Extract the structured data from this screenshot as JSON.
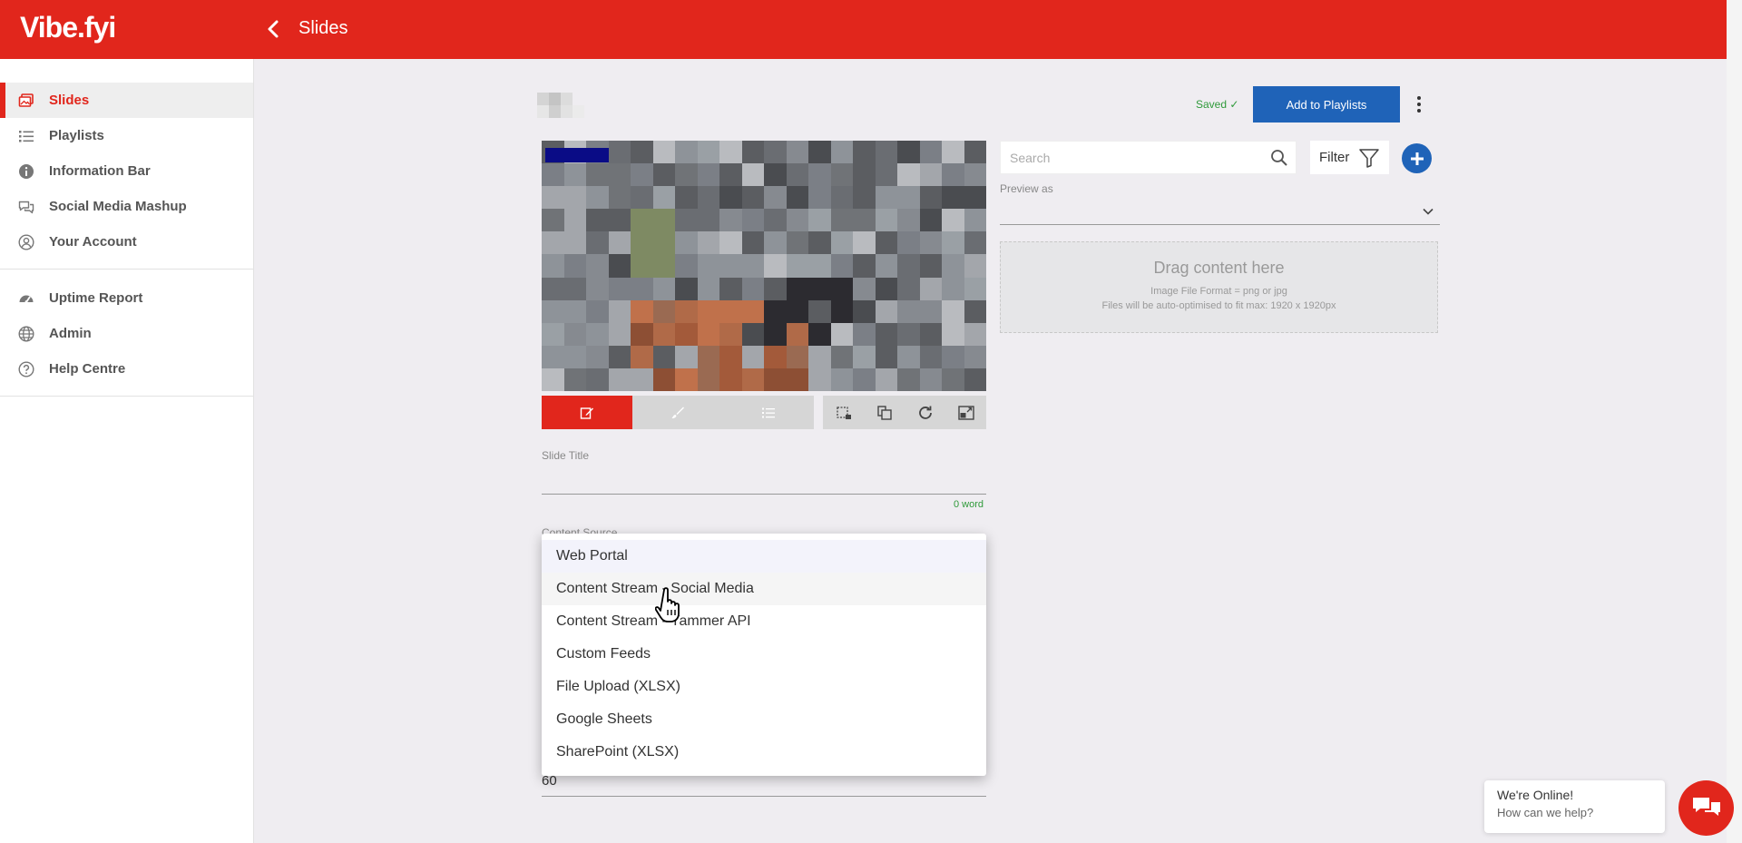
{
  "app": {
    "logo": "Vibe.fyi",
    "page_title": "Slides",
    "brand_color": "#e1261c",
    "accent_blue": "#1f63b8"
  },
  "sidebar": {
    "primary": [
      {
        "label": "Slides",
        "icon": "images-icon",
        "active": true
      },
      {
        "label": "Playlists",
        "icon": "list-icon"
      },
      {
        "label": "Information Bar",
        "icon": "info-icon"
      },
      {
        "label": "Social Media Mashup",
        "icon": "chat-icon"
      },
      {
        "label": "Your Account",
        "icon": "user-circle-icon"
      }
    ],
    "secondary": [
      {
        "label": "Uptime Report",
        "icon": "gauge-icon"
      },
      {
        "label": "Admin",
        "icon": "globe-icon"
      },
      {
        "label": "Help Centre",
        "icon": "help-icon"
      }
    ]
  },
  "header": {
    "saved_label": "Saved ✓",
    "add_to_playlists": "Add to Playlists"
  },
  "editor": {
    "slide_title_label": "Slide Title",
    "slide_title_value": "",
    "word_count": "0 word",
    "content_source_label": "Content Source",
    "duration_value": "60"
  },
  "dropdown": {
    "options": [
      "Web Portal",
      "Content Stream - Social Media",
      "Content Stream - Yammer API",
      "Custom Feeds",
      "File Upload (XLSX)",
      "Google Sheets",
      "SharePoint (XLSX)"
    ],
    "selected": "Web Portal",
    "hovered": "Content Stream - Social Media"
  },
  "right_panel": {
    "search_placeholder": "Search",
    "filter_label": "Filter",
    "preview_as_label": "Preview as",
    "preview_as_value": "",
    "dropzone_title": "Drag content here",
    "dropzone_line1": "Image File Format = png or jpg",
    "dropzone_line2": "Files will be auto-optimised to fit max: 1920 x 1920px"
  },
  "chat": {
    "title": "We're Online!",
    "subtitle": "How can we help?"
  }
}
